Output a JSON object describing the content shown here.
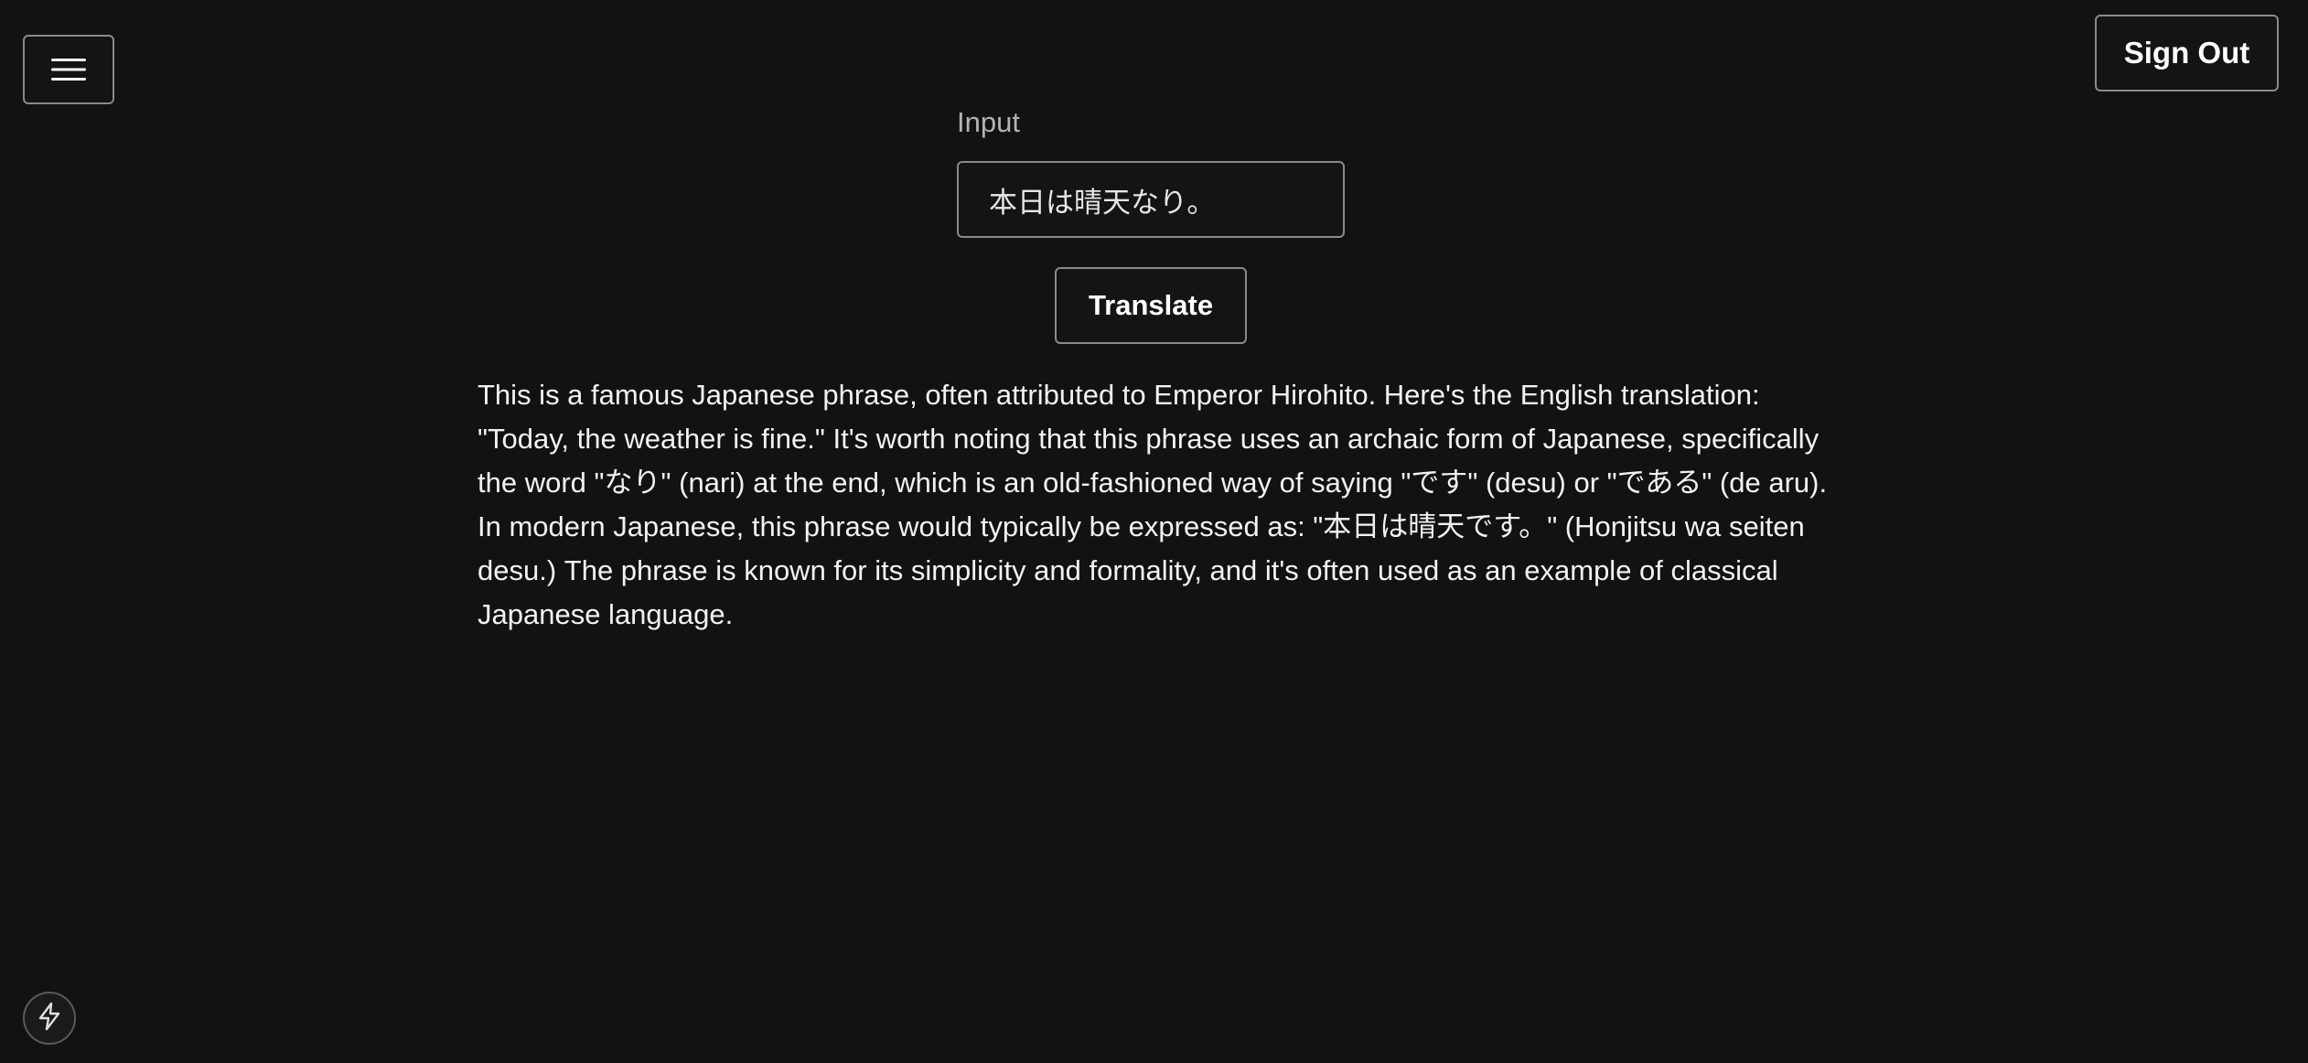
{
  "header": {
    "menu_icon": "hamburger-menu-icon",
    "sign_out_label": "Sign Out"
  },
  "form": {
    "input_label": "Input",
    "input_value": "本日は晴天なり。",
    "translate_label": "Translate"
  },
  "output": {
    "text": "This is a famous Japanese phrase, often attributed to Emperor Hirohito. Here's the English translation: \"Today, the weather is fine.\" It's worth noting that this phrase uses an archaic form of Japanese, specifically the word \"なり\" (nari) at the end, which is an old-fashioned way of saying \"です\" (desu) or \"である\" (de aru). In modern Japanese, this phrase would typically be expressed as: \"本日は晴天です。\" (Honjitsu wa seiten desu.) The phrase is known for its simplicity and formality, and it's often used as an example of classical Japanese language."
  },
  "footer": {
    "bolt_icon": "lightning-bolt-icon"
  },
  "colors": {
    "background": "#121212",
    "border": "#8a8a8a",
    "text": "#f2f2f2",
    "label": "#b4b4b4"
  }
}
